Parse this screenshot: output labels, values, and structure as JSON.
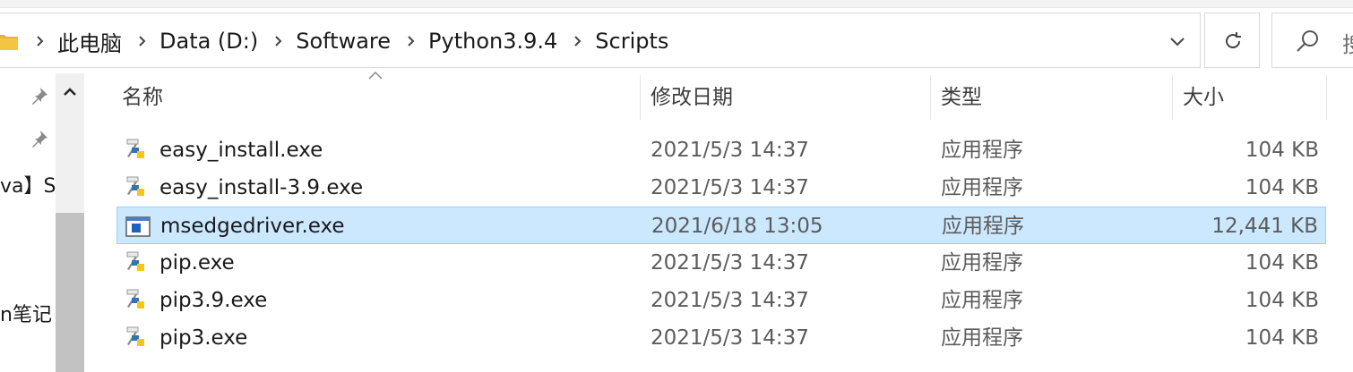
{
  "address": {
    "crumbs": [
      "此电脑",
      "Data (D:)",
      "Software",
      "Python3.9.4",
      "Scripts"
    ]
  },
  "search": {
    "placeholder": "搜"
  },
  "nav": {
    "items": [
      "va】S",
      "n笔记"
    ]
  },
  "columns": {
    "name": "名称",
    "modified": "修改日期",
    "type": "类型",
    "size": "大小"
  },
  "files": [
    {
      "name": "easy_install.exe",
      "modified": "2021/5/3 14:37",
      "type": "应用程序",
      "size": "104 KB",
      "icon": "python-exe-icon"
    },
    {
      "name": "easy_install-3.9.exe",
      "modified": "2021/5/3 14:37",
      "type": "应用程序",
      "size": "104 KB",
      "icon": "python-exe-icon"
    },
    {
      "name": "msedgedriver.exe",
      "modified": "2021/6/18 13:05",
      "type": "应用程序",
      "size": "12,441 KB",
      "icon": "app-window-icon",
      "selected": true
    },
    {
      "name": "pip.exe",
      "modified": "2021/5/3 14:37",
      "type": "应用程序",
      "size": "104 KB",
      "icon": "python-exe-icon"
    },
    {
      "name": "pip3.9.exe",
      "modified": "2021/5/3 14:37",
      "type": "应用程序",
      "size": "104 KB",
      "icon": "python-exe-icon"
    },
    {
      "name": "pip3.exe",
      "modified": "2021/5/3 14:37",
      "type": "应用程序",
      "size": "104 KB",
      "icon": "python-exe-icon"
    }
  ],
  "colors": {
    "selection": "#cce8ff",
    "selection_border": "#99d1ff",
    "folder": "#f4c542"
  }
}
